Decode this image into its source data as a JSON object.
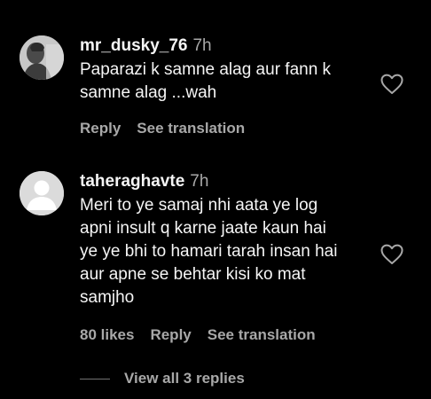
{
  "comments": [
    {
      "username": "mr_dusky_76",
      "time": "7h",
      "lines": [
        "Paparazi k samne alag aur fann k",
        "samne alag ...wah"
      ],
      "reply_label": "Reply",
      "translate_label": "See translation"
    },
    {
      "username": "taheraghavte",
      "time": "7h",
      "lines": [
        "Meri to ye samaj nhi aata ye log",
        "apni insult q karne jaate kaun hai",
        "ye ye bhi to hamari tarah insan hai",
        "aur apne se behtar kisi ko mat",
        "samjho"
      ],
      "likes_label": "80 likes",
      "reply_label": "Reply",
      "translate_label": "See translation"
    }
  ],
  "view_replies_label": "View all 3 replies",
  "icons": {
    "like": "heart-outline-icon",
    "default_avatar": "default-user-icon"
  },
  "colors": {
    "background": "#000000",
    "primary_text": "#f5f5f5",
    "secondary_text": "#a8a8a8"
  }
}
